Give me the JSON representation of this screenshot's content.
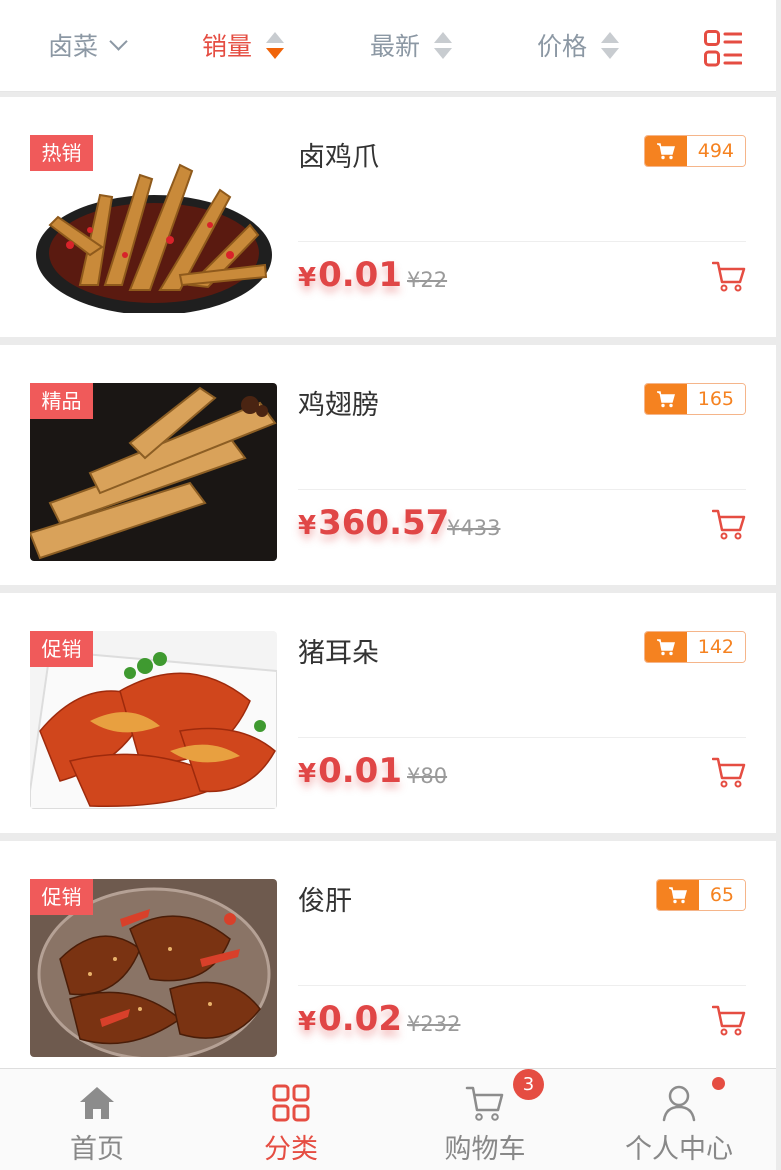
{
  "filter": {
    "category_label": "卤菜",
    "sales_label": "销量",
    "newest_label": "最新",
    "price_label": "价格",
    "active": "sales"
  },
  "products": [
    {
      "tag": "热销",
      "name": "卤鸡爪",
      "sales": "494",
      "price": "0.01",
      "old_price": "¥22",
      "image": "braised-chicken-feet"
    },
    {
      "tag": "精品",
      "name": "鸡翅膀",
      "sales": "165",
      "price": "360.57",
      "old_price": "¥433",
      "image": "braised-chicken-wings"
    },
    {
      "tag": "促销",
      "name": "猪耳朵",
      "sales": "142",
      "price": "0.01",
      "old_price": "¥80",
      "image": "pig-ear-salad"
    },
    {
      "tag": "促销",
      "name": "俊肝",
      "sales": "65",
      "price": "0.02",
      "old_price": "¥232",
      "image": "spicy-liver"
    }
  ],
  "currency_symbol": "¥",
  "tabbar": {
    "items": [
      {
        "label": "首页",
        "icon": "home-icon"
      },
      {
        "label": "分类",
        "icon": "grid-icon"
      },
      {
        "label": "购物车",
        "icon": "cart-icon"
      },
      {
        "label": "个人中心",
        "icon": "user-icon"
      }
    ],
    "active_index": 1,
    "cart_count": "3"
  },
  "colors": {
    "accent": "#e54d42",
    "orange": "#f58220",
    "tag_red": "#f05a5a",
    "muted": "#8c98a4"
  }
}
